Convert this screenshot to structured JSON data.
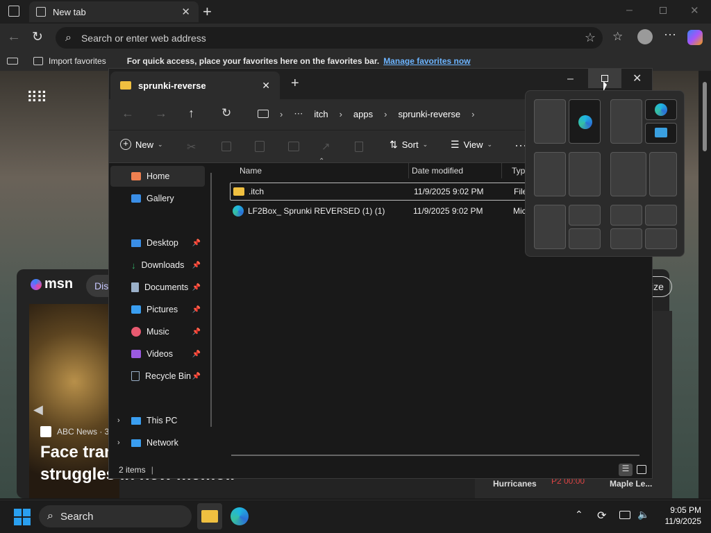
{
  "browser": {
    "tab_title": "New tab",
    "address_placeholder": "Search or enter web address",
    "favbar": {
      "import_label": "Import favorites",
      "hint": "For quick access, place your favorites here on the favorites bar.",
      "manage_link": "Manage favorites now"
    }
  },
  "msn": {
    "logo": "msn",
    "tab_partial": "Dis",
    "personalize_partial": "ize",
    "news_source": "ABC News · 3",
    "headline_1": "Face tran",
    "headline_2": "struggles in new memoir",
    "score_team_1": "Hurricanes",
    "score_time": "P2 00:00",
    "score_team_2": "Maple Le..."
  },
  "explorer": {
    "tab_title": "sprunki-reverse",
    "breadcrumb": [
      "itch",
      "apps",
      "sprunki-reverse"
    ],
    "commands": {
      "new": "New",
      "sort": "Sort",
      "view": "View"
    },
    "sidebar": {
      "home": "Home",
      "gallery": "Gallery",
      "pinned": [
        "Desktop",
        "Downloads",
        "Documents",
        "Pictures",
        "Music",
        "Videos",
        "Recycle Bin"
      ],
      "this_pc": "This PC",
      "network": "Network"
    },
    "columns": {
      "name": "Name",
      "date": "Date modified",
      "type": "Typ"
    },
    "files": [
      {
        "name": ".itch",
        "date": "11/9/2025 9:02 PM",
        "type": "File"
      },
      {
        "name": "LF2Box_ Sprunki REVERSED (1) (1)",
        "date": "11/9/2025 9:02 PM",
        "type": "Mic"
      }
    ],
    "status": "2 items"
  },
  "taskbar": {
    "search": "Search",
    "time": "9:05 PM",
    "date": "11/9/2025"
  },
  "colors": {
    "accent": "#4a9eff",
    "folder": "#f0c040",
    "link": "#6cb4ff"
  }
}
